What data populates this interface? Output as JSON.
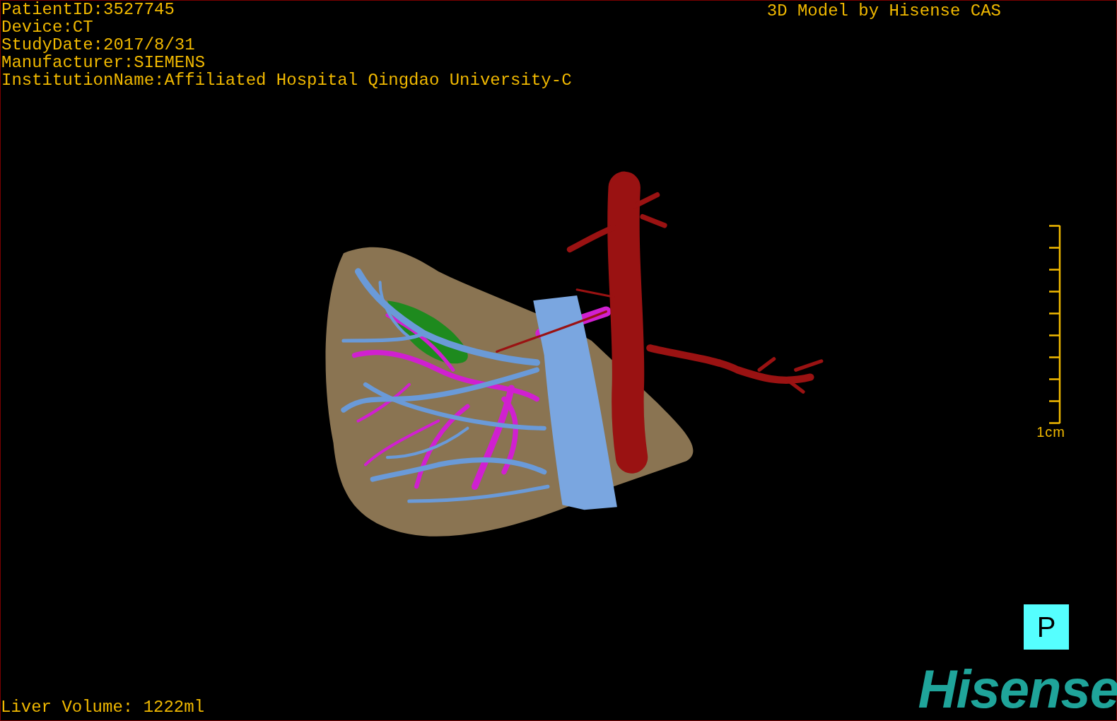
{
  "study_info": [
    "PatientID:3527745",
    "Device:CT",
    "StudyDate:2017/8/31",
    "Manufacturer:SIEMENS",
    "InstitutionName:Affiliated Hospital Qingdao University-C"
  ],
  "title": "3D Model by Hisense CAS",
  "scale_bar": {
    "label": "1cm"
  },
  "orientation_marker": "P",
  "liver_volume": "Liver Volume: 1222ml",
  "logo": "Hisense"
}
